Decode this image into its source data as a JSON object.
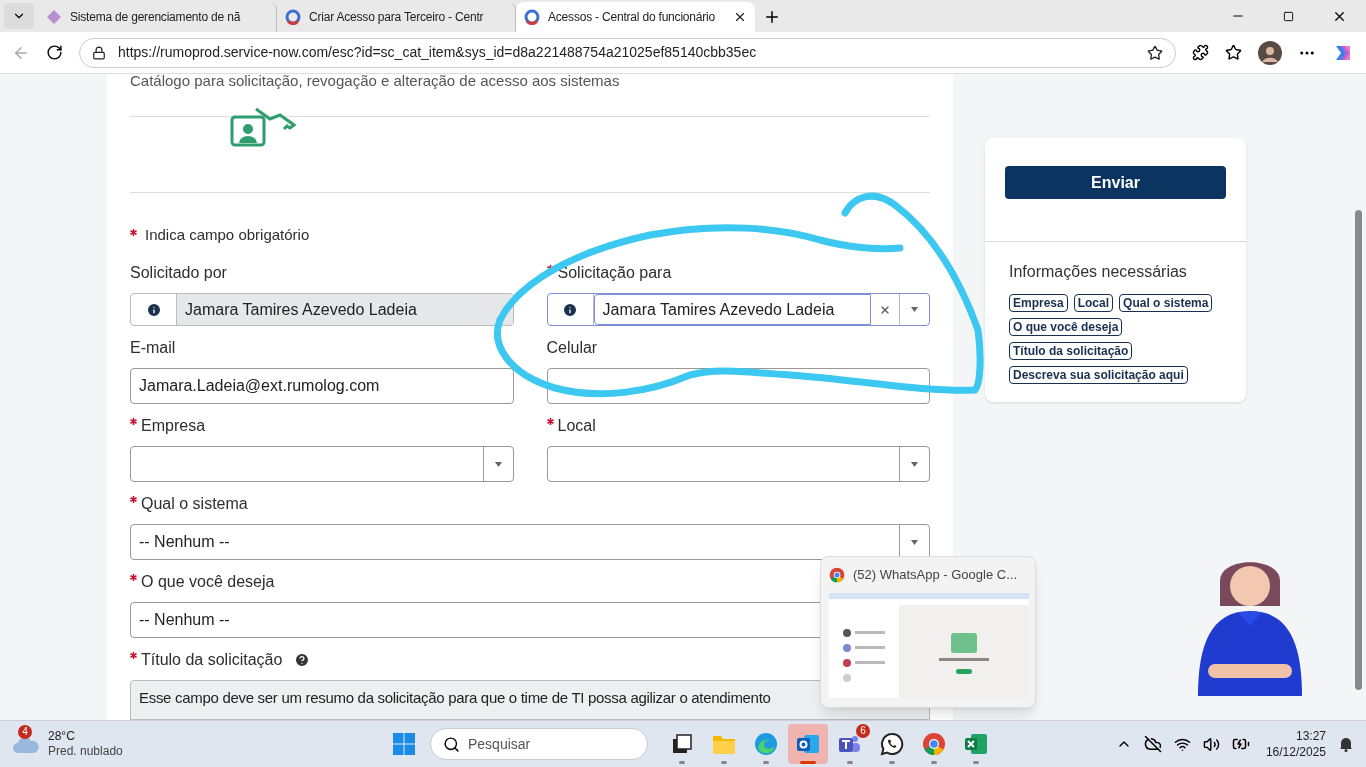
{
  "browser": {
    "tabs": [
      {
        "title": "Sistema de gerenciamento de nã",
        "kind": "diamond",
        "selected": false
      },
      {
        "title": "Criar Acesso para Terceiro - Centr",
        "kind": "servicenow",
        "selected": false
      },
      {
        "title": "Acessos - Central do funcionário",
        "kind": "servicenow",
        "selected": true
      }
    ],
    "url": "https://rumoprod.service-now.com/esc?id=sc_cat_item&sys_id=d8a221488754a21025ef85140cbb35ec"
  },
  "form": {
    "description": "Catálogo para solicitação, revogação e alteração de acesso aos sistemas",
    "required_note": "Indica campo obrigatório",
    "rows": [
      [
        {
          "label": "Solicitado por",
          "required": false,
          "kind": "reference",
          "value": "Jamara Tamires Azevedo Ladeia",
          "readonly": true
        },
        {
          "label": "Solicitação para",
          "required": true,
          "kind": "reference",
          "value": "Jamara Tamires Azevedo Ladeia",
          "readonly": false
        }
      ],
      [
        {
          "label": "E-mail",
          "required": false,
          "kind": "text",
          "value": "Jamara.Ladeia@ext.rumolog.com"
        },
        {
          "label": "Celular",
          "required": false,
          "kind": "text"
        }
      ],
      [
        {
          "label": "Empresa",
          "required": true,
          "kind": "select"
        },
        {
          "label": "Local",
          "required": true,
          "kind": "select"
        }
      ],
      [
        {
          "label": "Qual o sistema",
          "required": true,
          "kind": "select",
          "value": "-- Nenhum --"
        }
      ],
      [
        {
          "label": "O que você deseja",
          "required": true,
          "kind": "select",
          "value": "-- Nenhum --"
        }
      ],
      [
        {
          "label": "Título da solicitação",
          "required": true,
          "kind": "hint",
          "help": true,
          "value": "Esse campo deve ser um resumo da solicitação para que o time de TI possa agilizar o atendimento"
        }
      ]
    ]
  },
  "sidebar": {
    "submit": "Enviar",
    "info_title": "Informações necessárias",
    "tags": [
      [
        "Empresa",
        "Local",
        "Qual o sistema"
      ],
      [
        "O que você deseja"
      ],
      [
        "Título da solicitação"
      ],
      [
        "Descreva sua solicitação aqui"
      ]
    ]
  },
  "preview": {
    "title": "(52) WhatsApp - Google C..."
  },
  "taskbar": {
    "weather": {
      "badge": "4",
      "temp": "28°C",
      "condition": "Pred. nublado"
    },
    "search": "Pesquisar",
    "apps": [
      {
        "kind": "taskview",
        "active": false
      },
      {
        "kind": "files",
        "active": false
      },
      {
        "kind": "edge",
        "active": false
      },
      {
        "kind": "outlook",
        "active": true
      },
      {
        "kind": "teams",
        "badge": "6",
        "active": false
      },
      {
        "kind": "whatsapp",
        "active": false
      },
      {
        "kind": "chrome",
        "active": false
      },
      {
        "kind": "excel",
        "active": false
      }
    ],
    "time": "13:27",
    "date": "16/12/2025"
  }
}
